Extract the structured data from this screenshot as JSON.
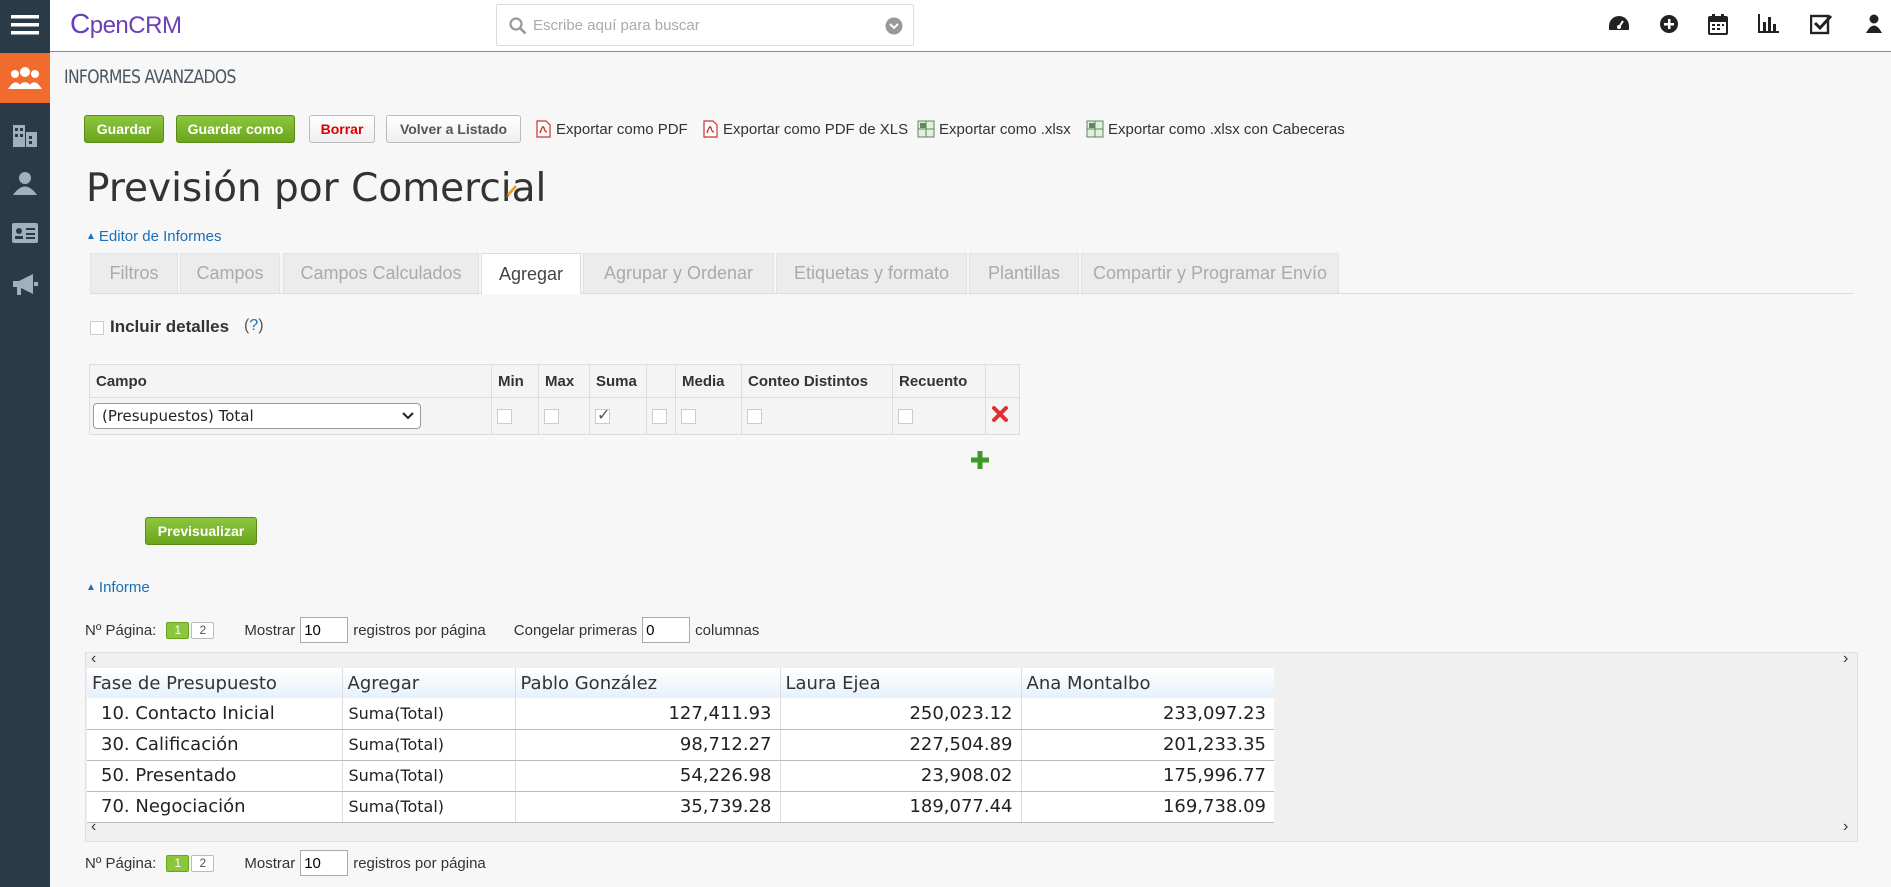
{
  "app": {
    "logo_first": "C",
    "logo_rest": "penCRM"
  },
  "search": {
    "placeholder": "Escribe aquí para buscar"
  },
  "header": {
    "module_title": "INFORMES AVANZADOS"
  },
  "toolbar": {
    "save": "Guardar",
    "save_as": "Guardar como",
    "delete": "Borrar",
    "back": "Volver a Listado",
    "export_pdf": "Exportar como PDF",
    "export_pdf_xls": "Exportar como PDF de XLS",
    "export_xlsx": "Exportar como .xlsx",
    "export_xlsx_headers": "Exportar como .xlsx con Cabeceras"
  },
  "report": {
    "title": "Previsión por Comercial"
  },
  "editor_link": "Editor de Informes",
  "tabs": [
    "Filtros",
    "Campos",
    "Campos Calculados",
    "Agregar",
    "Agrupar y Ordenar",
    "Etiquetas y formato",
    "Plantillas",
    "Compartir y Programar Envío"
  ],
  "active_tab": "Agregar",
  "include_details": {
    "label": "Incluir detalles",
    "help_open": "(",
    "help_q": "?",
    "help_close": ")"
  },
  "aggregate": {
    "headers": [
      "Campo",
      "Min",
      "Max",
      "Suma",
      "",
      "Media",
      "Conteo Distintos",
      "Recuento"
    ],
    "row": {
      "field": "(Presupuestos) Total"
    }
  },
  "preview_button": "Previsualizar",
  "informe_link": "Informe",
  "pagination": {
    "page_label": "Nº Página:",
    "pages": [
      "1",
      "2"
    ],
    "show_label": "Mostrar",
    "per_page_value": "10",
    "per_page_suffix": "registros por página",
    "freeze_label": "Congelar primeras",
    "freeze_value": "0",
    "freeze_suffix": "columnas"
  },
  "report_table": {
    "headers": [
      "Fase de Presupuesto",
      "Agregar",
      "Pablo González",
      "Laura Ejea",
      "Ana Montalbo"
    ],
    "rows": [
      [
        "10. Contacto Inicial",
        "Suma(Total)",
        "127,411.93",
        "250,023.12",
        "233,097.23"
      ],
      [
        "30. Calificación",
        "Suma(Total)",
        "98,712.27",
        "227,504.89",
        "201,233.35"
      ],
      [
        "50. Presentado",
        "Suma(Total)",
        "54,226.98",
        "23,908.02",
        "175,996.77"
      ],
      [
        "70. Negociación",
        "Suma(Total)",
        "35,739.28",
        "189,077.44",
        "169,738.09"
      ]
    ]
  },
  "colors": {
    "accent": "#f26b2e",
    "sidebar": "#2b3a47",
    "green": "#8cc63f",
    "link": "#1a6fb8"
  }
}
